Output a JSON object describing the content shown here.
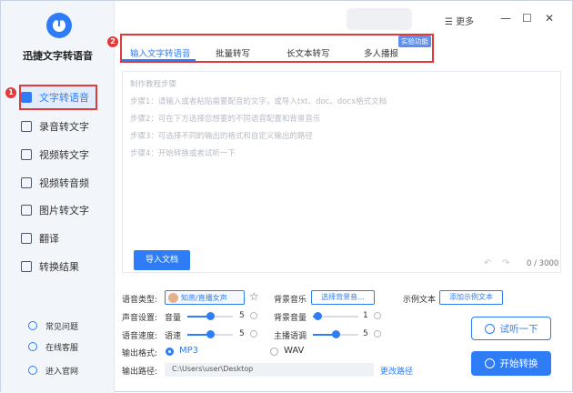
{
  "app": {
    "name": "迅捷文字转语音",
    "logo_letter": "T"
  },
  "titlebar": {
    "more_label": "☰ 更多",
    "minimize": "—",
    "maximize": "☐",
    "close": "✕"
  },
  "sidebar": {
    "items": [
      {
        "label": "文字转语音",
        "icon": "tts-icon",
        "active": true
      },
      {
        "label": "录音转文字",
        "icon": "record-icon"
      },
      {
        "label": "视频转文字",
        "icon": "video-text-icon"
      },
      {
        "label": "视频转音频",
        "icon": "video-audio-icon"
      },
      {
        "label": "图片转文字",
        "icon": "image-text-icon"
      },
      {
        "label": "翻译",
        "icon": "translate-icon"
      },
      {
        "label": "转换结果",
        "icon": "result-icon"
      }
    ],
    "footer": [
      {
        "label": "常见问题",
        "icon": "help-icon"
      },
      {
        "label": "在线客服",
        "icon": "service-icon"
      },
      {
        "label": "进入官网",
        "icon": "website-icon"
      }
    ],
    "badge_1": "1"
  },
  "tabs": {
    "badge_2": "2",
    "items": [
      "输入文字转语音",
      "批量转写",
      "长文本转写",
      "多人播报"
    ],
    "lab_tag": "实验功能"
  },
  "editor": {
    "lines": [
      "制作教程步骤",
      "步骤1：请输入或者粘贴需要配音的文字，或导入txt、doc、docx格式文档",
      "步骤2：可在下方选择您想要的不同语音配置和背景音乐",
      "步骤3：可选择不同的输出的格式和自定义输出的路径",
      "步骤4：开始转换或者试听一下"
    ],
    "import_label": "导入文档",
    "undo": "↶",
    "redo": "↷",
    "count": "0 / 3000"
  },
  "settings": {
    "voice_type_label": "语音类型:",
    "voice_name": "知燕/直播女声",
    "bgm_label": "背景音乐",
    "bgm_button": "选择背景音...",
    "sample_label": "示例文本",
    "sample_button": "添加示例文本",
    "sound_label": "声音设置:",
    "volume_label": "音量",
    "volume_value": "5",
    "volume_level": 0.5,
    "bg_volume_label": "背景音量",
    "bg_volume_value": "1",
    "bg_volume_level": 0.1,
    "speed_row_label": "语音速度:",
    "speed_label": "语速",
    "speed_value": "5",
    "speed_level": 0.5,
    "pitch_label": "主播语调",
    "pitch_value": "5",
    "pitch_level": 0.5,
    "format_label": "输出格式:",
    "format_mp3": "MP3",
    "format_wav": "WAV",
    "path_label": "输出路径:",
    "path_value": "C:\\Users\\user\\Desktop",
    "change_path": "更改路径"
  },
  "actions": {
    "listen": "试听一下",
    "start": "开始转换"
  },
  "colors": {
    "accent": "#2f7df6",
    "highlight": "#e23a3a"
  }
}
